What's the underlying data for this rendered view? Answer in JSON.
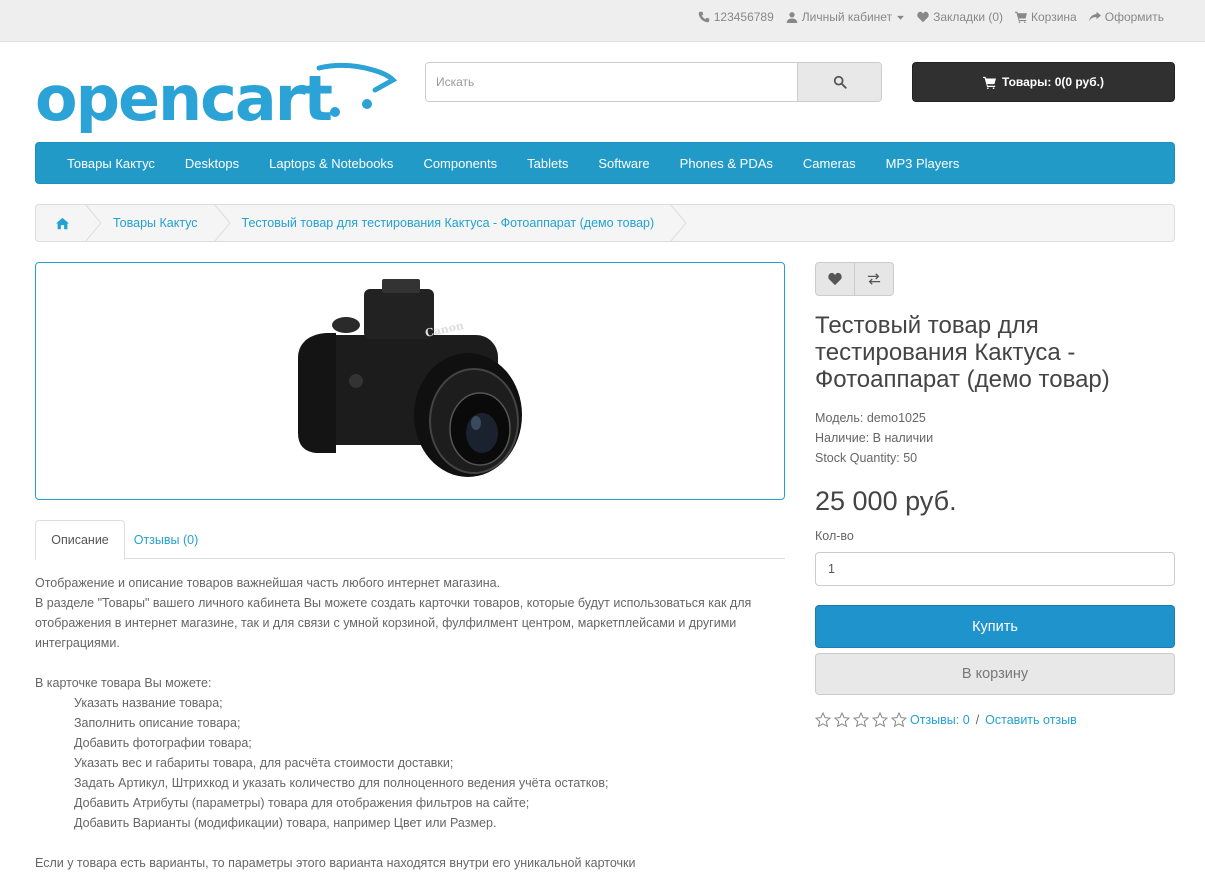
{
  "topbar": {
    "phone": "123456789",
    "account": "Личный кабинет",
    "wishlist": "Закладки (0)",
    "cart": "Корзина",
    "checkout": "Оформить"
  },
  "search": {
    "placeholder": "Искать"
  },
  "cart_button": "Товары: 0(0 руб.)",
  "menu": [
    "Товары Кактус",
    "Desktops",
    "Laptops & Notebooks",
    "Components",
    "Tablets",
    "Software",
    "Phones & PDAs",
    "Cameras",
    "MP3 Players"
  ],
  "breadcrumb": [
    "Товары Кактус",
    "Тестовый товар для тестирования Кактуса - Фотоаппарат (демо товар)"
  ],
  "tabs": {
    "description": "Описание",
    "reviews": "Отзывы (0)"
  },
  "description": {
    "intro1": "Отображение и описание товаров важнейшая часть любого интернет магазина.",
    "intro2": "В разделе \"Товары\" вашего личного кабинета Вы можете создать карточки товаров, которые будут использоваться как для",
    "intro3": "отображения в интернет магазине, так и для связи с умной корзиной, фулфилмент центром, маркетплейсами и другими",
    "intro4": "интеграциями.",
    "list_title": "В карточке товара Вы можете:",
    "items": [
      "Указать название товара;",
      "Заполнить описание товара;",
      "Добавить фотографии товара;",
      "Указать вес и габариты товара, для расчёта стоимости доставки;",
      "Задать Артикул, Штрихкод и указать количество для полноценного ведения учёта остатков;",
      "Добавить Атрибуты (параметры) товара для отображения фильтров на сайте;",
      "Добавить Варианты (модификации) товара, например Цвет или Размер."
    ],
    "outro": "Если у товара есть варианты, то параметры этого варианта находятся внутри его уникальной карточки"
  },
  "product": {
    "title": "Тестовый товар для тестирования Кактуса - Фотоаппарат (демо товар)",
    "model": "Модель: demo1025",
    "availability": "Наличие: В наличии",
    "stock": "Stock Quantity: 50",
    "price": "25 000 руб.",
    "qty_label": "Кол-во",
    "qty_value": "1",
    "buy": "Купить",
    "add_to_cart": "В корзину",
    "reviews_link": "Отзывы: 0",
    "write_review": "Оставить отзыв",
    "camera_brand": "Canon"
  },
  "colors": {
    "accent": "#229ac8",
    "link": "#23a1d1",
    "dark_button": "#303030"
  }
}
